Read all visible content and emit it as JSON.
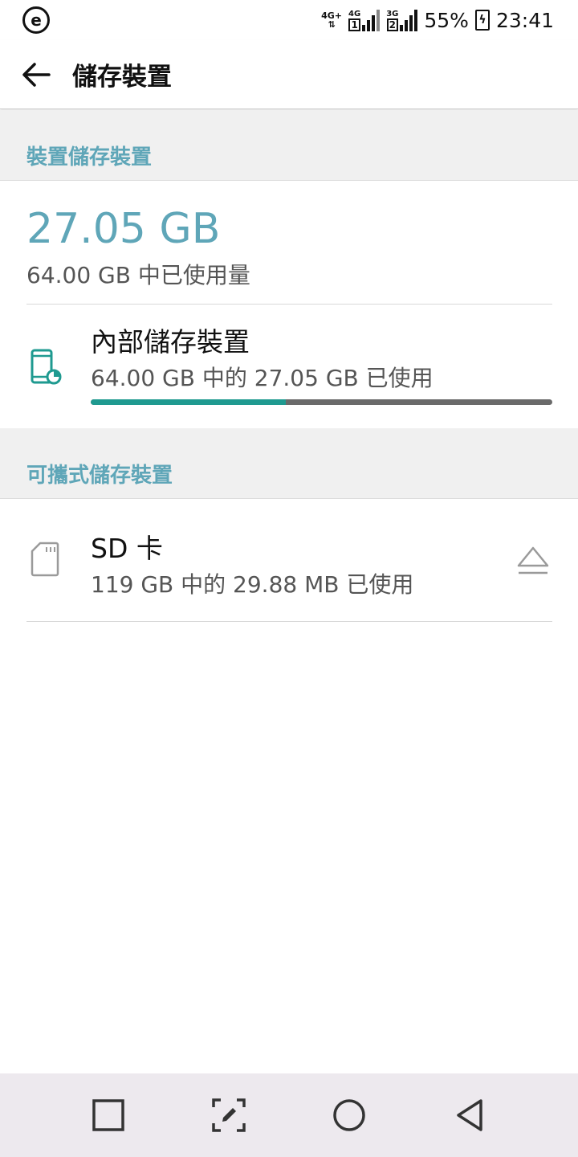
{
  "status_bar": {
    "network_badge": "4G+",
    "sim1_type": "4G",
    "sim1_slot": "1",
    "sim2_type": "3G",
    "sim2_slot": "2",
    "battery": "55%",
    "time": "23:41",
    "icons": [
      "app-e-icon",
      "signal-icon",
      "battery-charging-icon"
    ]
  },
  "app_bar": {
    "title": "儲存裝置",
    "back_icon": "arrow-left-icon"
  },
  "device_storage": {
    "header": "裝置儲存裝置",
    "used_amount": "27.05 GB",
    "used_caption": "64.00 GB 中已使用量",
    "internal": {
      "title": "內部儲存裝置",
      "subtitle": "64.00 GB 中的 27.05 GB 已使用",
      "used_fraction": 0.4227,
      "icon": "phone-storage-icon"
    }
  },
  "portable_storage": {
    "header": "可攜式儲存裝置",
    "sd_card": {
      "title": "SD 卡",
      "subtitle": "119 GB 中的 29.88 MB 已使用",
      "icon": "sd-card-icon",
      "action_icon": "eject-icon"
    }
  },
  "nav_bar": {
    "icons": [
      "recents-square-icon",
      "capture-edit-icon",
      "home-circle-icon",
      "back-triangle-icon"
    ]
  },
  "colors": {
    "accent": "#5fa6b8",
    "progress": "#1f9a90",
    "track": "#6a6a6a",
    "section_bg": "#f0f0f0",
    "nav_bg": "#ede9ee"
  }
}
